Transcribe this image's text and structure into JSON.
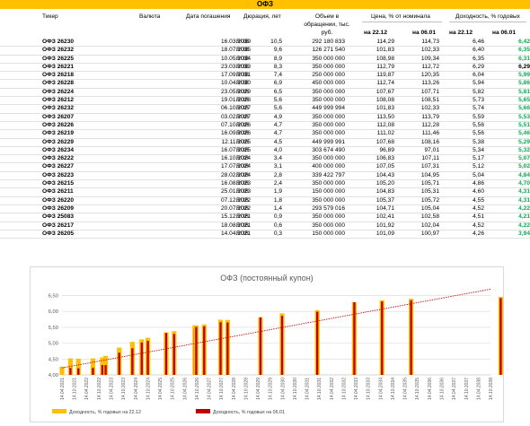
{
  "title": "ОФЗ",
  "headers": {
    "ticker": "Тикер",
    "currency": "Валюта",
    "maturity": "Дата погашения",
    "duration": "Дюрация, лет",
    "volume_line1": "Объем в",
    "volume_line2": "обращении, тыс.",
    "volume_line3": "руб.",
    "price": "Цена, % от номинала",
    "yield": "Доходность, % годовых",
    "date1": "на 22.12",
    "date2": "на 06.01"
  },
  "rows": [
    {
      "ticker": "ОФЗ 26230",
      "currency": "RUB",
      "maturity": "16.03.2039",
      "duration": "10,5",
      "volume": "292 180 833",
      "price1": "114,29",
      "price2": "114,73",
      "yield1": "6,46",
      "yield2": "6,42",
      "dir": "down"
    },
    {
      "ticker": "ОФЗ 26232",
      "currency": "RUB",
      "maturity": "18.07.2035",
      "duration": "9,6",
      "volume": "126 271 540",
      "price1": "101,83",
      "price2": "102,33",
      "yield1": "6,40",
      "yield2": "6,35",
      "dir": "down"
    },
    {
      "ticker": "ОФЗ 26225",
      "currency": "RUB",
      "maturity": "10.05.2034",
      "duration": "8,9",
      "volume": "350 000 000",
      "price1": "108,98",
      "price2": "109,34",
      "yield1": "6,35",
      "yield2": "6,31",
      "dir": "down"
    },
    {
      "ticker": "ОФЗ 26221",
      "currency": "RUB",
      "maturity": "23.03.2033",
      "duration": "8,3",
      "volume": "350 000 000",
      "price1": "112,79",
      "price2": "112,72",
      "yield1": "6,29",
      "yield2": "6,29",
      "dir": "flat"
    },
    {
      "ticker": "ОФЗ 26218",
      "currency": "RUB",
      "maturity": "17.09.2031",
      "duration": "7,4",
      "volume": "250 000 000",
      "price1": "119,87",
      "price2": "120,35",
      "yield1": "6,04",
      "yield2": "5,99",
      "dir": "down"
    },
    {
      "ticker": "ОФЗ 26228",
      "currency": "RUB",
      "maturity": "10.04.2030",
      "duration": "6,9",
      "volume": "450 000 000",
      "price1": "112,74",
      "price2": "113,26",
      "yield1": "5,94",
      "yield2": "5,86",
      "dir": "down"
    },
    {
      "ticker": "ОФЗ 26224",
      "currency": "RUB",
      "maturity": "23.05.2029",
      "duration": "6,5",
      "volume": "350 000 000",
      "price1": "107,67",
      "price2": "107,71",
      "yield1": "5,82",
      "yield2": "5,81",
      "dir": "down"
    },
    {
      "ticker": "ОФЗ 26212",
      "currency": "RUB",
      "maturity": "19.01.2028",
      "duration": "5,6",
      "volume": "350 000 000",
      "price1": "108,08",
      "price2": "108,51",
      "yield1": "5,73",
      "yield2": "5,65",
      "dir": "down"
    },
    {
      "ticker": "ОФЗ 26232",
      "currency": "RUB",
      "maturity": "06.10.2027",
      "duration": "5,6",
      "volume": "449 999 994",
      "price1": "101,83",
      "price2": "102,33",
      "yield1": "5,74",
      "yield2": "5,66",
      "dir": "down"
    },
    {
      "ticker": "ОФЗ 26207",
      "currency": "RUB",
      "maturity": "03.02.2027",
      "duration": "4,9",
      "volume": "350 000 000",
      "price1": "113,50",
      "price2": "113,79",
      "yield1": "5,59",
      "yield2": "5,53",
      "dir": "down"
    },
    {
      "ticker": "ОФЗ 26226",
      "currency": "RUB",
      "maturity": "07.10.2026",
      "duration": "4,7",
      "volume": "350 000 000",
      "price1": "112,08",
      "price2": "112,28",
      "yield1": "5,56",
      "yield2": "5,51",
      "dir": "down"
    },
    {
      "ticker": "ОФЗ 26219",
      "currency": "RUB",
      "maturity": "16.09.2026",
      "duration": "4,7",
      "volume": "350 000 000",
      "price1": "111,02",
      "price2": "111,46",
      "yield1": "5,56",
      "yield2": "5,46",
      "dir": "down"
    },
    {
      "ticker": "ОФЗ 26229",
      "currency": "RUB",
      "maturity": "12.11.2025",
      "duration": "4,5",
      "volume": "449 999 991",
      "price1": "107,68",
      "price2": "108,16",
      "yield1": "5,38",
      "yield2": "5,29",
      "dir": "down"
    },
    {
      "ticker": "ОФЗ 26234",
      "currency": "RUB",
      "maturity": "16.07.2025",
      "duration": "4,0",
      "volume": "303 674 490",
      "price1": "96,89",
      "price2": "97,01",
      "yield1": "5,34",
      "yield2": "5,32",
      "dir": "down"
    },
    {
      "ticker": "ОФЗ 26222",
      "currency": "RUB",
      "maturity": "16.10.2024",
      "duration": "3,4",
      "volume": "350 000 000",
      "price1": "106,83",
      "price2": "107,11",
      "yield1": "5,17",
      "yield2": "5,07",
      "dir": "down"
    },
    {
      "ticker": "ОФЗ 26227",
      "currency": "RUB",
      "maturity": "17.07.2024",
      "duration": "3,1",
      "volume": "400 000 000",
      "price1": "107,05",
      "price2": "107,31",
      "yield1": "5,12",
      "yield2": "5,02",
      "dir": "down"
    },
    {
      "ticker": "ОФЗ 26223",
      "currency": "RUB",
      "maturity": "28.02.2024",
      "duration": "2,8",
      "volume": "339 422 797",
      "price1": "104,43",
      "price2": "104,95",
      "yield1": "5,04",
      "yield2": "4,84",
      "dir": "down"
    },
    {
      "ticker": "ОФЗ 26215",
      "currency": "RUB",
      "maturity": "16.08.2023",
      "duration": "2,4",
      "volume": "350 000 000",
      "price1": "105,20",
      "price2": "105,71",
      "yield1": "4,86",
      "yield2": "4,70",
      "dir": "down"
    },
    {
      "ticker": "ОФЗ 26211",
      "currency": "RUB",
      "maturity": "25.01.2023",
      "duration": "1,9",
      "volume": "150 000 000",
      "price1": "104,83",
      "price2": "105,31",
      "yield1": "4,60",
      "yield2": "4,31",
      "dir": "down"
    },
    {
      "ticker": "ОФЗ 26220",
      "currency": "RUB",
      "maturity": "07.12.2022",
      "duration": "1,8",
      "volume": "350 000 000",
      "price1": "105,37",
      "price2": "105,72",
      "yield1": "4,55",
      "yield2": "4,31",
      "dir": "down"
    },
    {
      "ticker": "ОФЗ 26209",
      "currency": "RUB",
      "maturity": "20.07.2022",
      "duration": "1,4",
      "volume": "293 579 016",
      "price1": "104,71",
      "price2": "105,04",
      "yield1": "4,52",
      "yield2": "4,22",
      "dir": "down",
      "sep": true
    },
    {
      "ticker": "ОФЗ 25083",
      "currency": "RUB",
      "maturity": "15.12.2021",
      "duration": "0,9",
      "volume": "350 000 000",
      "price1": "102,41",
      "price2": "102,58",
      "yield1": "4,51",
      "yield2": "4,21",
      "dir": "down"
    },
    {
      "ticker": "ОФЗ 26217",
      "currency": "RUB",
      "maturity": "18.08.2021",
      "duration": "0,6",
      "volume": "350 000 000",
      "price1": "101,92",
      "price2": "102,04",
      "yield1": "4,52",
      "yield2": "4,22",
      "dir": "down"
    },
    {
      "ticker": "ОФЗ 26205",
      "currency": "RUB",
      "maturity": "14.04.2021",
      "duration": "0,3",
      "volume": "150 000 000",
      "price1": "101,09",
      "price2": "100,97",
      "yield1": "4,26",
      "yield2": "3,94",
      "dir": "down"
    }
  ],
  "colors": {
    "accent": "#ffc000",
    "green": "#00b050",
    "series1": "#ffc000",
    "series2": "#c00000",
    "trend": "#c00000"
  },
  "chart_data": {
    "type": "bar",
    "title": "ОФЗ (постоянный купон)",
    "x_date_format": "DD.MM.YYYY",
    "x_ticks": [
      "14.04.2021",
      "14.10.2021",
      "14.04.2022",
      "14.10.2022",
      "14.04.2023",
      "14.10.2023",
      "14.04.2024",
      "14.10.2024",
      "14.04.2025",
      "14.10.2025",
      "14.04.2026",
      "14.10.2026",
      "14.04.2027",
      "14.10.2027",
      "14.04.2028",
      "14.10.2028",
      "14.04.2029",
      "14.10.2029",
      "14.04.2030",
      "14.10.2030",
      "14.04.2031",
      "14.10.2031",
      "14.04.2032",
      "14.10.2032",
      "14.04.2033",
      "14.10.2033",
      "14.04.2034",
      "14.10.2034",
      "14.04.2035",
      "14.10.2035",
      "14.04.2036",
      "14.10.2036",
      "14.04.2037",
      "14.10.2037",
      "14.04.2038",
      "14.10.2038"
    ],
    "y_ticks": [
      "4,00",
      "4,50",
      "5,00",
      "5,50",
      "6,00",
      "6,50"
    ],
    "ylim": [
      4.0,
      6.6
    ],
    "dates": [
      "14.04.2021",
      "18.08.2021",
      "15.12.2021",
      "20.07.2022",
      "07.12.2022",
      "25.01.2023",
      "16.08.2023",
      "28.02.2024",
      "17.07.2024",
      "16.10.2024",
      "16.07.2025",
      "12.11.2025",
      "16.09.2026",
      "07.10.2026",
      "03.02.2027",
      "06.10.2027",
      "19.01.2028",
      "23.05.2029",
      "10.04.2030",
      "17.09.2031",
      "23.03.2033",
      "10.05.2034",
      "18.07.2035",
      "16.03.2039"
    ],
    "series": [
      {
        "name": "Доходность, % годовых на 22.12",
        "values": [
          4.26,
          4.52,
          4.51,
          4.52,
          4.55,
          4.6,
          4.86,
          5.04,
          5.12,
          5.17,
          5.34,
          5.38,
          5.56,
          5.56,
          5.59,
          5.74,
          5.73,
          5.82,
          5.94,
          6.04,
          6.29,
          6.35,
          6.4,
          6.46
        ]
      },
      {
        "name": "Доходность, % годовых на 06.01",
        "values": [
          3.94,
          4.22,
          4.21,
          4.22,
          4.31,
          4.31,
          4.7,
          4.84,
          5.02,
          5.07,
          5.32,
          5.29,
          5.46,
          5.51,
          5.53,
          5.66,
          5.65,
          5.81,
          5.86,
          5.99,
          6.29,
          6.31,
          6.35,
          6.42
        ]
      }
    ],
    "trendline": {
      "from": [
        4.22,
        4.25
      ],
      "to": [
        6.7,
        6.7
      ]
    },
    "grid": true,
    "legend": "bottom"
  }
}
